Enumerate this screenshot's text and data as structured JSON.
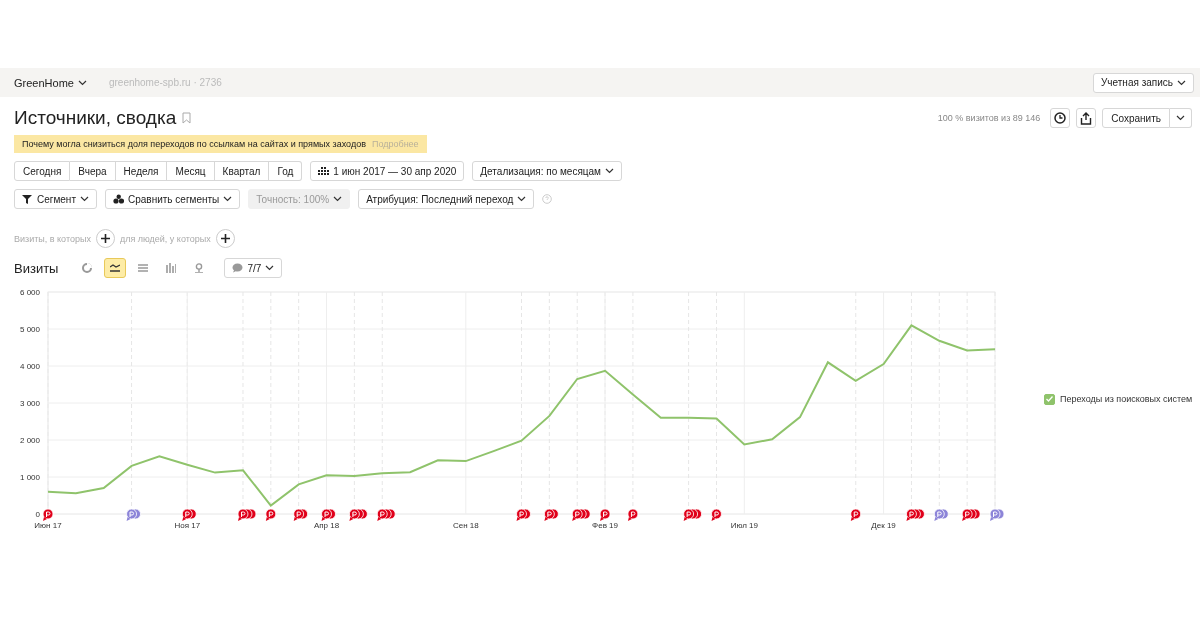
{
  "top_bar": {
    "counter": "GreenHome",
    "site": "greenhome-spb.ru · 2736",
    "account_button": "Учетная запись"
  },
  "header": {
    "title": "Источники, сводка",
    "visits_share": "100 % визитов из 89 146",
    "save_button": "Сохранить"
  },
  "notice": {
    "text": "Почему могла снизиться доля переходов по ссылкам на сайтах и прямых заходов",
    "link": "Подробнее"
  },
  "periods": [
    {
      "label": "Сегодня",
      "selected": false
    },
    {
      "label": "Вчера",
      "selected": false
    },
    {
      "label": "Неделя",
      "selected": false
    },
    {
      "label": "Месяц",
      "selected": false
    },
    {
      "label": "Квартал",
      "selected": false
    },
    {
      "label": "Год",
      "selected": false
    }
  ],
  "date_range": "1 июн 2017 — 30 апр 2020",
  "detail": "Детализация: по месяцам",
  "filters": [
    {
      "kind": "segment",
      "label": "Сегмент",
      "disabled": false
    },
    {
      "kind": "compare",
      "label": "Сравнить сегменты",
      "disabled": false
    },
    {
      "kind": "accuracy",
      "label": "Точность: 100%",
      "disabled": true
    },
    {
      "kind": "attribution",
      "label": "Атрибуция: Последний переход",
      "disabled": false
    }
  ],
  "conditions": {
    "visits_label": "Визиты, в которых",
    "people_label": "для людей, у которых"
  },
  "chart_section": {
    "title": "Визиты",
    "chart_types": [
      {
        "kind": "pie",
        "selected": false
      },
      {
        "kind": "line",
        "selected": true
      },
      {
        "kind": "area",
        "selected": false
      },
      {
        "kind": "bar",
        "selected": false
      },
      {
        "kind": "map",
        "selected": false
      }
    ],
    "notes_button": "7/7",
    "legend": [
      {
        "checked": true
      }
    ],
    "markers": [
      {
        "kind": "single",
        "color": "#e0001a"
      },
      {
        "kind": "none"
      },
      {
        "kind": "none"
      },
      {
        "kind": "double",
        "color": "#8c84d8"
      },
      {
        "kind": "none"
      },
      {
        "kind": "double",
        "color": "#e0001a"
      },
      {
        "kind": "none"
      },
      {
        "kind": "triple",
        "color": "#e0001a"
      },
      {
        "kind": "single",
        "color": "#e0001a"
      },
      {
        "kind": "double",
        "color": "#e0001a"
      },
      {
        "kind": "double",
        "color": "#e0001a"
      },
      {
        "kind": "triple",
        "color": "#e0001a"
      },
      {
        "kind": "triple",
        "color": "#e0001a"
      },
      {
        "kind": "none"
      },
      {
        "kind": "none"
      },
      {
        "kind": "none"
      },
      {
        "kind": "none"
      },
      {
        "kind": "double",
        "color": "#e0001a"
      },
      {
        "kind": "double",
        "color": "#e0001a"
      },
      {
        "kind": "triple",
        "color": "#e0001a"
      },
      {
        "kind": "single",
        "color": "#e0001a"
      },
      {
        "kind": "single",
        "color": "#e0001a"
      },
      {
        "kind": "none"
      },
      {
        "kind": "triple",
        "color": "#e0001a"
      },
      {
        "kind": "single",
        "color": "#e0001a"
      },
      {
        "kind": "none"
      },
      {
        "kind": "none"
      },
      {
        "kind": "none"
      },
      {
        "kind": "none"
      },
      {
        "kind": "single",
        "color": "#e0001a"
      },
      {
        "kind": "none"
      },
      {
        "kind": "triple",
        "color": "#e0001a"
      },
      {
        "kind": "double",
        "color": "#8c84d8"
      },
      {
        "kind": "triple",
        "color": "#e0001a"
      },
      {
        "kind": "double",
        "color": "#8c84d8"
      }
    ],
    "chart_data": {
      "type": "line",
      "categories": [
        "Июн 17",
        null,
        null,
        null,
        null,
        "Ноя 17",
        null,
        null,
        null,
        null,
        "Апр 18",
        null,
        null,
        null,
        null,
        "Сен 18",
        null,
        null,
        null,
        null,
        "Фев 19",
        null,
        null,
        null,
        null,
        "Июл 19",
        null,
        null,
        null,
        null,
        "Дек 19",
        null,
        null,
        null,
        null
      ],
      "series": [
        {
          "name": "Переходы из поисковых систем",
          "color": "#8fc36b",
          "values": [
            600,
            560,
            700,
            1300,
            1560,
            1330,
            1120,
            1180,
            230,
            800,
            1050,
            1030,
            1100,
            1130,
            1450,
            1430,
            1700,
            1980,
            2650,
            3650,
            3870,
            3230,
            2600,
            2600,
            2580,
            1880,
            2020,
            2620,
            4100,
            3600,
            4050,
            5100,
            4680,
            4420,
            4450
          ]
        }
      ],
      "ylim": [
        0,
        6000
      ],
      "yticks": [
        {
          "value": 0,
          "label": "0"
        },
        {
          "value": 1000,
          "label": "1 000"
        },
        {
          "value": 2000,
          "label": "2 000"
        },
        {
          "value": 3000,
          "label": "3 000"
        },
        {
          "value": 4000,
          "label": "4 000"
        },
        {
          "value": 5000,
          "label": "5 000"
        },
        {
          "value": 6000,
          "label": "6 000"
        }
      ],
      "grid": true
    }
  }
}
